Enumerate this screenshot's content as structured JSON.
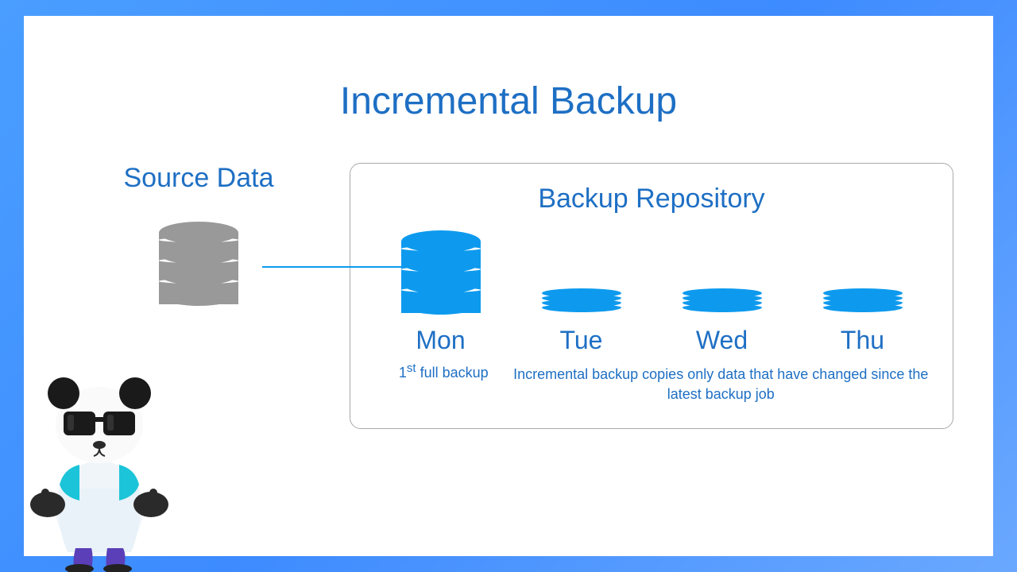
{
  "title": "Incremental Backup",
  "source": {
    "title": "Source Data"
  },
  "repository": {
    "title": "Backup Repository",
    "days": [
      {
        "label": "Mon",
        "type": "full"
      },
      {
        "label": "Tue",
        "type": "incremental"
      },
      {
        "label": "Wed",
        "type": "incremental"
      },
      {
        "label": "Thu",
        "type": "incremental"
      }
    ],
    "full_note_prefix": "1",
    "full_note_sup": "st",
    "full_note_suffix": " full backup",
    "incremental_note": "Incremental backup copies only data that have changed since the latest backup job"
  },
  "colors": {
    "accent": "#1e6fc4",
    "icon_blue": "#0d9aee",
    "icon_gray": "#999"
  }
}
